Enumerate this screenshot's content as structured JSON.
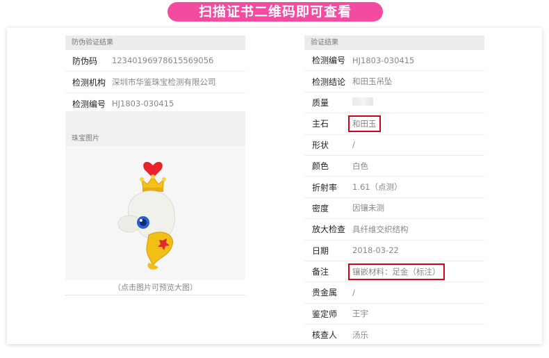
{
  "banner": "扫描证书二维码即可查看",
  "left_panel": {
    "section_title": "防伪验证结果",
    "rows": [
      {
        "label": "防伪码",
        "value": "12340196978615569056"
      },
      {
        "label": "检测机构",
        "value": "深圳市华鉴珠宝检测有限公司"
      },
      {
        "label": "检测编号",
        "value": "HJ1803-030415"
      }
    ],
    "jewel_section_title": "珠宝图片",
    "jewel_caption": "（点击图片可预览大图）"
  },
  "right_panel": {
    "section_title": "验证结果",
    "rows": [
      {
        "label": "检测编号",
        "value": "HJ1803-030415"
      },
      {
        "label": "检测结论",
        "value": "和田玉吊坠"
      },
      {
        "label": "质量",
        "value": ""
      },
      {
        "label": "主石",
        "value": "和田玉"
      },
      {
        "label": "形状",
        "value": "/"
      },
      {
        "label": "颜色",
        "value": "白色"
      },
      {
        "label": "折射率",
        "value": "1.61（点测）"
      },
      {
        "label": "密度",
        "value": "因镶未测"
      },
      {
        "label": "放大检查",
        "value": "具纤维交织结构"
      },
      {
        "label": "日期",
        "value": "2018-03-22"
      },
      {
        "label": "备注",
        "value": "镶嵌材料：足金（标注）"
      },
      {
        "label": "贵金属",
        "value": "/"
      },
      {
        "label": "鉴定师",
        "value": "王宇"
      },
      {
        "label": "核查人",
        "value": "汤乐"
      }
    ]
  },
  "colors": {
    "banner": "#f24ba0",
    "highlight_box": "#d4001a"
  }
}
